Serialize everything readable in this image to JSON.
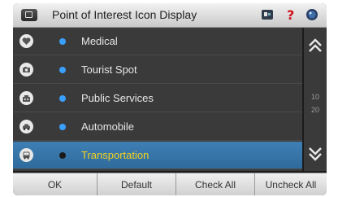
{
  "header": {
    "title": "Point of Interest Icon Display",
    "icons": [
      "back-icon",
      "map-icon",
      "help-icon",
      "globe-icon"
    ]
  },
  "list": {
    "items": [
      {
        "label": "Medical",
        "icon": "heart-icon",
        "checked": true
      },
      {
        "label": "Tourist Spot",
        "icon": "camera-icon",
        "checked": true
      },
      {
        "label": "Public Services",
        "icon": "building-icon",
        "checked": true
      },
      {
        "label": "Automobile",
        "icon": "car-icon",
        "checked": true
      },
      {
        "label": "Transportation",
        "icon": "bus-icon",
        "checked": false,
        "selected": true
      }
    ]
  },
  "scroll": {
    "page_current": "10",
    "page_total": "20"
  },
  "buttons": {
    "ok": "OK",
    "default": "Default",
    "check_all": "Check All",
    "uncheck_all": "Uncheck All"
  },
  "colors": {
    "checked_dot": "#3aa0ff",
    "unchecked_dot": "#1a1a1a",
    "selected_text": "#f3d21d",
    "selected_bg": "#3574a8"
  }
}
